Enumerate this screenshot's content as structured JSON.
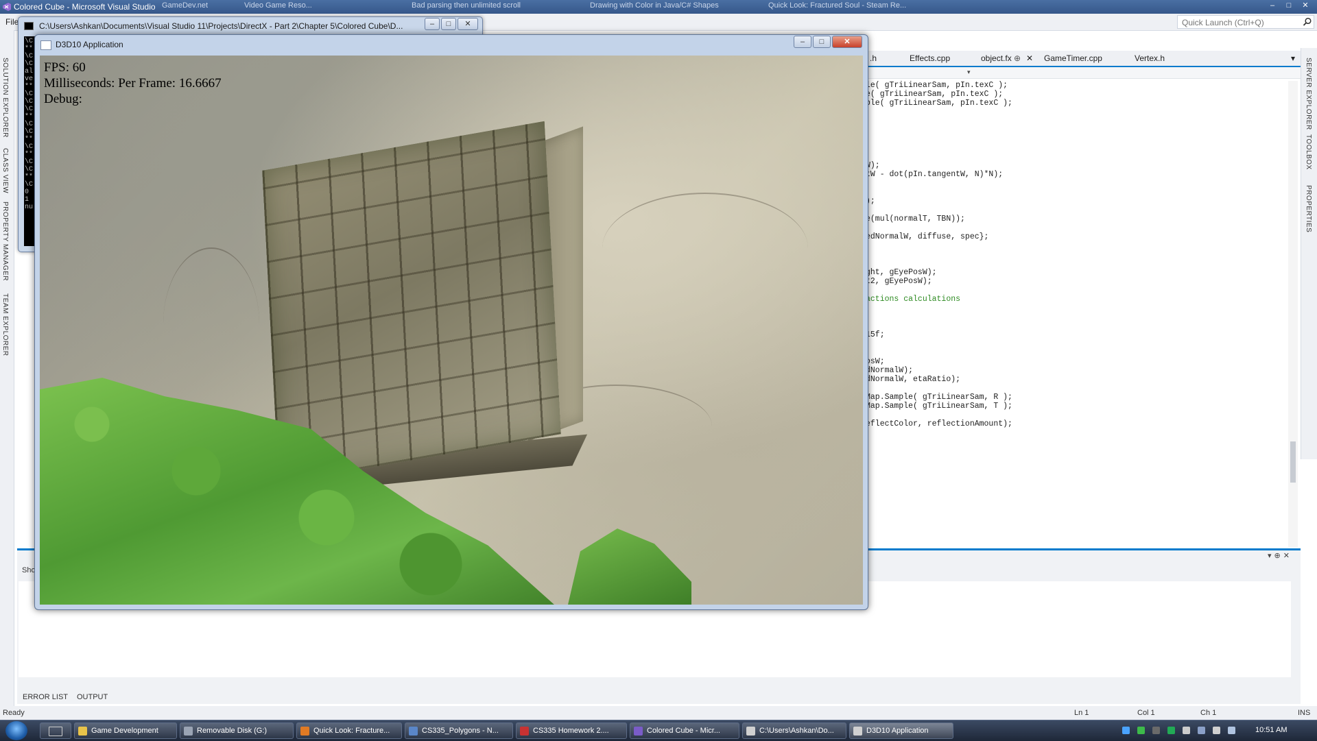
{
  "vs": {
    "window_title": "Colored Cube - Microsoft Visual Studio",
    "menu_first": "File",
    "quick_launch_placeholder": "Quick Launch (Ctrl+Q)",
    "left_tabs": [
      "SOLUTION EXPLORER",
      "CLASS VIEW",
      "PROPERTY MANAGER",
      "TEAM EXPLORER"
    ],
    "right_tabs": [
      "SERVER EXPLORER",
      "TOOLBOX",
      "PROPERTIES"
    ],
    "doc_tabs": [
      {
        "label": ".h",
        "active": false
      },
      {
        "label": "Effects.cpp",
        "active": false
      },
      {
        "label": "object.fx",
        "active": true
      },
      {
        "label": "GameTimer.cpp",
        "active": false
      },
      {
        "label": "Vertex.h",
        "active": false
      }
    ],
    "code_lines": [
      {
        "text": "le( gTriLinearSam, pIn.texC );",
        "comment": false
      },
      {
        "text": "e( gTriLinearSam, pIn.texC );",
        "comment": false
      },
      {
        "text": "ple( gTriLinearSam, pIn.texC );",
        "comment": false
      },
      {
        "text": "W);",
        "comment": false
      },
      {
        "text": "tW - dot(pIn.tangentW, N)*N);",
        "comment": false
      },
      {
        "text": ");",
        "comment": false
      },
      {
        "text": "e(mul(normalT, TBN));",
        "comment": false
      },
      {
        "text": "edNormalW, diffuse, spec};",
        "comment": false
      },
      {
        "text": "ght, gEyePosW);",
        "comment": false
      },
      {
        "text": "t2, gEyePosW);",
        "comment": false
      },
      {
        "text": "actions calculations",
        "comment": true
      },
      {
        "text": "15f;",
        "comment": false
      },
      {
        "text": "osW;",
        "comment": false
      },
      {
        "text": "dNormalW);",
        "comment": false
      },
      {
        "text": "dNormalW, etaRatio);",
        "comment": false
      },
      {
        "text": "Map.Sample( gTriLinearSam, R );",
        "comment": false
      },
      {
        "text": "Map.Sample( gTriLinearSam, T );",
        "comment": false
      },
      {
        "text": "eflectColor, reflectionAmount);",
        "comment": false
      }
    ],
    "output_show_label": "Sho",
    "output_tabs": [
      "ERROR LIST",
      "OUTPUT"
    ],
    "status": {
      "ready": "Ready",
      "ln": "Ln 1",
      "col": "Col 1",
      "ch": "Ch 1",
      "ins": "INS"
    }
  },
  "background_tabs": [
    "GameDev.net",
    "Video Game Reso...",
    "Bad parsing then unlimited scroll",
    "Drawing with Color in Java/C# Shapes",
    "Quick Look: Fractured Soul - Steam Re..."
  ],
  "console": {
    "title": "C:\\Users\\Ashkan\\Documents\\Visual Studio 11\\Projects\\DirectX - Part 2\\Chapter 5\\Colored Cube\\D...",
    "lines": [
      "\\C",
      "**",
      "\\C",
      "\\C",
      "al",
      "ve",
      "**",
      "\\C",
      "\\C",
      "\\C",
      "**",
      "\\C",
      "\\C",
      "**",
      "\\C",
      "**",
      "\\C",
      "\\C",
      "**",
      "\\C",
      "0",
      "1",
      "nu"
    ]
  },
  "d3d": {
    "title": "D3D10 Application",
    "fps": "FPS: 60",
    "ms_per_frame": "Milliseconds: Per Frame: 16.6667",
    "debug": "Debug:"
  },
  "taskbar": {
    "items": [
      {
        "label": "Game Development",
        "color": "#e8c34a"
      },
      {
        "label": "Removable Disk (G:)",
        "color": "#9aa4b4"
      },
      {
        "label": "Quick Look: Fracture...",
        "color": "#e07a24"
      },
      {
        "label": "CS335_Polygons - N...",
        "color": "#5a86c8"
      },
      {
        "label": "CS335 Homework 2....",
        "color": "#c83232"
      },
      {
        "label": "Colored Cube - Micr...",
        "color": "#7a5cc8"
      },
      {
        "label": "C:\\Users\\Ashkan\\Do...",
        "color": "#d0d0d0"
      },
      {
        "label": "D3D10 Application",
        "color": "#d0d0d0"
      }
    ],
    "clock": "10:51 AM"
  }
}
